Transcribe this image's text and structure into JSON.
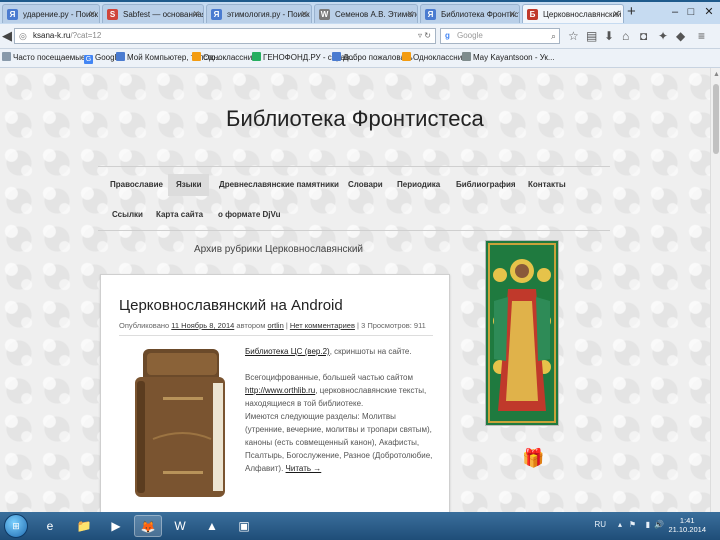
{
  "tabs": [
    {
      "label": "ударение.ру - Поиск в ...",
      "icon": "yandex-icon",
      "color": "#4a7bd0"
    },
    {
      "label": "Sabfest — основанная и...",
      "icon": "sabfest-icon",
      "color": "#d0453b"
    },
    {
      "label": "этимология.ру - Поиск ...",
      "icon": "yandex-icon",
      "color": "#4a7bd0"
    },
    {
      "label": "Семенов А.В. Этимолог...",
      "icon": "wordpress-icon",
      "color": "#7a7a7a"
    },
    {
      "label": "Библиотека Фронтистесв...",
      "icon": "yandex-icon",
      "color": "#4a7bd0"
    },
    {
      "label": "Церковнославянский | ...",
      "icon": "library-icon",
      "color": "#c0392b"
    }
  ],
  "address": {
    "host": "ksana-k.ru",
    "rest": "/?cat=12"
  },
  "search": {
    "placeholder": "Google",
    "engine": "g"
  },
  "bookmarks": [
    {
      "label": "Часто посещаемые",
      "color": "#8899aa"
    },
    {
      "label": "Google",
      "color": "#4285f4"
    },
    {
      "label": "Мой Компьютер, толсто...",
      "color": "#4a7bd0"
    },
    {
      "label": "Одноклассники",
      "color": "#f39c12"
    },
    {
      "label": "ГЕНОФОНД.РУ - справ...",
      "color": "#27ae60"
    },
    {
      "label": "Добро пожаловать",
      "color": "#4a7bd0"
    },
    {
      "label": "Одноклассники",
      "color": "#f39c12"
    },
    {
      "label": "May Kayantsoon - Ук...",
      "color": "#7f8c8d"
    }
  ],
  "site": {
    "title": "Библиотека Фронтистеса",
    "menu_row1": [
      "Православие",
      "Языки",
      "Древнеславянские памятники",
      "Словари",
      "Периодика",
      "Библиография",
      "Контакты"
    ],
    "menu_row2": [
      "Ссылки",
      "Карта сайта",
      "о формате DjVu"
    ],
    "active_menu": "Языки",
    "archive_heading": "Архив рубрики Церковнославянский"
  },
  "post": {
    "title": "Церковнославянский на Android",
    "meta_prefix": "Опубликовано",
    "date": "11 Ноябрь 8, 2014",
    "by": "автором",
    "author": "ortlin",
    "comments": "Нет комментариев",
    "views": "3 Просмотров: 911",
    "link_text": "Библиотека ЦС (вер.2)",
    "after_link": ", скриншоты на сайте.",
    "p1": "Всегоцифрованные, большей частью сайтом",
    "url": "http://www.orthlib.ru",
    "p2": ", церковнославянские тексты, находящиеся в той библиотеке.",
    "p3": "Имеются следующие разделы: Молитвы (утренние, вечерние, молитвы и тропари святым), каноны (есть совмещенный канон), Акафисты, Псалтырь, Богослужение, Разное (Добротолюбие, Алфавит).",
    "read_more": "Читать →"
  },
  "taskbar": {
    "apps": [
      "windows-explorer",
      "file-explorer",
      "media-player",
      "firefox",
      "word",
      "google-drive",
      "scanner"
    ],
    "lang": "RU",
    "time": "1:41",
    "date": "21.10.2014"
  }
}
